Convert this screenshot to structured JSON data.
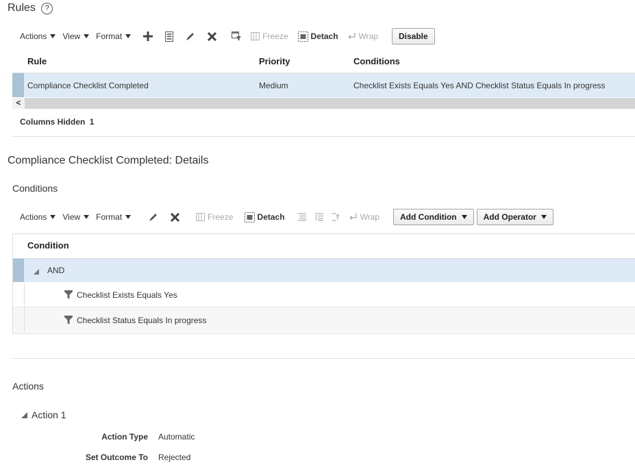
{
  "rules": {
    "title": "Rules",
    "toolbar": {
      "actions": "Actions",
      "view": "View",
      "format": "Format",
      "freeze": "Freeze",
      "detach": "Detach",
      "wrap": "Wrap",
      "disable": "Disable"
    },
    "columns": [
      "Rule",
      "Priority",
      "Conditions"
    ],
    "rows": [
      {
        "rule": "Compliance Checklist Completed",
        "priority": "Medium",
        "conditions": "Checklist Exists Equals Yes AND Checklist Status Equals In progress"
      }
    ],
    "scroll_left": "<",
    "columns_hidden_label": "Columns Hidden",
    "columns_hidden_count": "1"
  },
  "details": {
    "title": "Compliance Checklist Completed: Details",
    "conditions": {
      "title": "Conditions",
      "toolbar": {
        "actions": "Actions",
        "view": "View",
        "format": "Format",
        "freeze": "Freeze",
        "detach": "Detach",
        "wrap": "Wrap",
        "add_condition": "Add Condition",
        "add_operator": "Add Operator"
      },
      "column": "Condition",
      "tree": [
        {
          "label": "AND",
          "level": 0
        },
        {
          "label": "Checklist Exists Equals Yes",
          "level": 1
        },
        {
          "label": "Checklist Status Equals In progress",
          "level": 1
        }
      ]
    },
    "actions": {
      "title": "Actions",
      "action1": {
        "label": "Action 1",
        "type_label": "Action Type",
        "type_value": "Automatic",
        "outcome_label": "Set Outcome To",
        "outcome_value": "Rejected"
      }
    }
  },
  "colors": {
    "selected_row": "#deebf7",
    "row_marker": "#a9c2d6",
    "scrollbar": "#d4d4d4",
    "disabled_text": "#a8a8a8",
    "divider": "#e0e0e0"
  }
}
